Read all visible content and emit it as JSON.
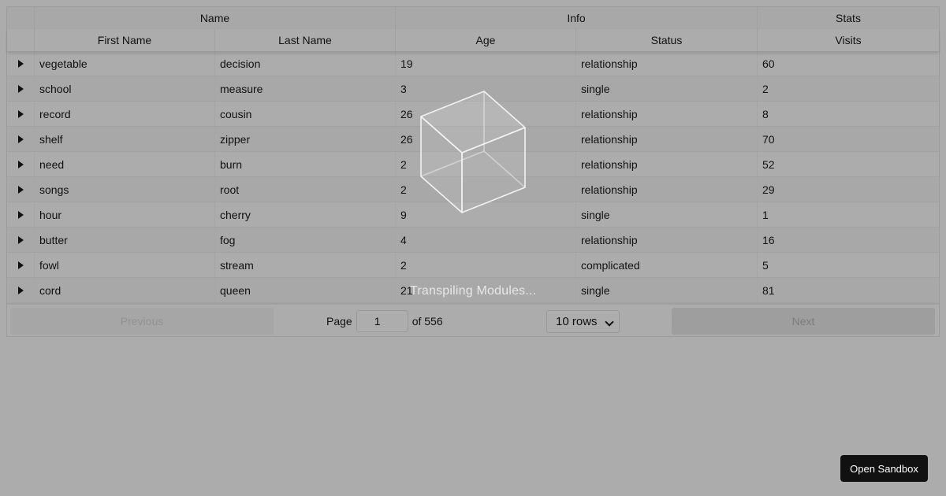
{
  "table": {
    "group_headers": [
      "",
      "Name",
      "Info",
      "Stats"
    ],
    "column_headers": [
      "",
      "First Name",
      "Last Name",
      "Age",
      "Status",
      "Visits"
    ],
    "rows": [
      {
        "first": "vegetable",
        "last": "decision",
        "age": "19",
        "status": "relationship",
        "visits": "60"
      },
      {
        "first": "school",
        "last": "measure",
        "age": "3",
        "status": "single",
        "visits": "2"
      },
      {
        "first": "record",
        "last": "cousin",
        "age": "26",
        "status": "relationship",
        "visits": "8"
      },
      {
        "first": "shelf",
        "last": "zipper",
        "age": "26",
        "status": "relationship",
        "visits": "70"
      },
      {
        "first": "need",
        "last": "burn",
        "age": "2",
        "status": "relationship",
        "visits": "52"
      },
      {
        "first": "songs",
        "last": "root",
        "age": "2",
        "status": "relationship",
        "visits": "29"
      },
      {
        "first": "hour",
        "last": "cherry",
        "age": "9",
        "status": "single",
        "visits": "1"
      },
      {
        "first": "butter",
        "last": "fog",
        "age": "4",
        "status": "relationship",
        "visits": "16"
      },
      {
        "first": "fowl",
        "last": "stream",
        "age": "2",
        "status": "complicated",
        "visits": "5"
      },
      {
        "first": "cord",
        "last": "queen",
        "age": "21",
        "status": "single",
        "visits": "81"
      }
    ]
  },
  "pagination": {
    "previous_label": "Previous",
    "next_label": "Next",
    "page_label": "Page",
    "current_page": "1",
    "of_label": "of 556",
    "rows_select": "10 rows"
  },
  "overlay": {
    "loading_text": "Transpiling Modules...",
    "open_sandbox_label": "Open Sandbox",
    "icon": "cube-icon"
  },
  "colors": {
    "overlay_background": "#acacac",
    "button_dark": "#111111"
  }
}
